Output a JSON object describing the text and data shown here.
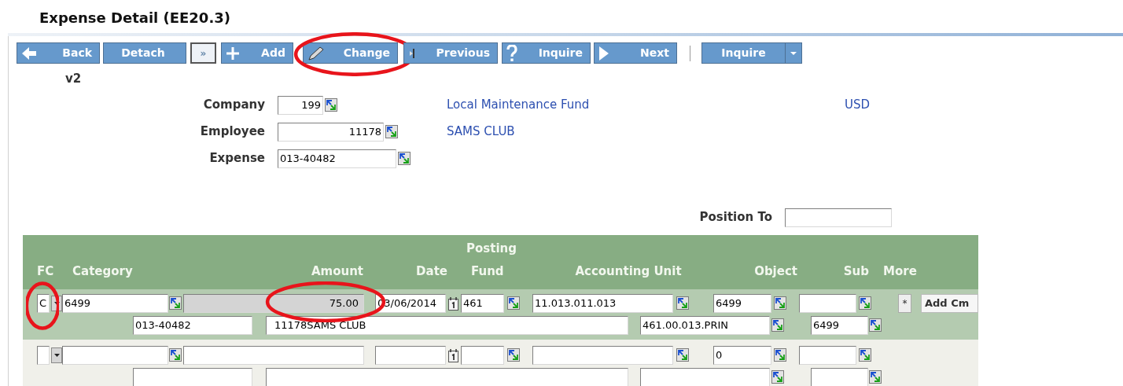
{
  "title": "Expense Detail (EE20.3)",
  "toolbar": {
    "buttons": [
      {
        "label": "Back",
        "kind": "back",
        "circled": false
      },
      {
        "label": "Detach",
        "kind": "plain",
        "circled": false
      },
      {
        "label": "»",
        "kind": "expand",
        "circled": false
      },
      {
        "label": "Add",
        "kind": "add",
        "circled": false
      },
      {
        "label": "Change",
        "kind": "change",
        "circled": true
      },
      {
        "label": "Previous",
        "kind": "previous",
        "circled": false
      },
      {
        "label": "Inquire",
        "kind": "inquire",
        "circled": false
      },
      {
        "label": "Next",
        "kind": "next",
        "circled": false
      }
    ],
    "menu_button": {
      "label": "Inquire"
    }
  },
  "version": "v2",
  "header": {
    "company": {
      "label": "Company",
      "value": "199",
      "name": "Local Maintenance Fund",
      "currency": "USD"
    },
    "employee": {
      "label": "Employee",
      "value": "11178",
      "name": "SAMS CLUB"
    },
    "expense": {
      "label": "Expense",
      "value": "013-40482"
    }
  },
  "position_to": {
    "label": "Position To"
  },
  "table": {
    "group_heading": "Posting",
    "columns": [
      "FC",
      "Category",
      "Amount",
      "Date",
      "Fund",
      "Accounting Unit",
      "Object",
      "Sub",
      "More"
    ],
    "lines": [
      {
        "fc": "C",
        "category": "6499",
        "amount": "75.00",
        "date": "03/06/2014",
        "fund": "461",
        "accounting_unit": "11.013.011.013",
        "object": "6499",
        "reference": "013-40482",
        "description": "11178SAMS CLUB",
        "account": "461.00.013.PRIN",
        "sub_account": "6499",
        "more_button": "*",
        "comment_button": "Add Cm",
        "fc_circled": true,
        "amount_circled": true
      },
      {
        "object": "0",
        "fc_circled": false,
        "amount_circled": false
      }
    ]
  }
}
